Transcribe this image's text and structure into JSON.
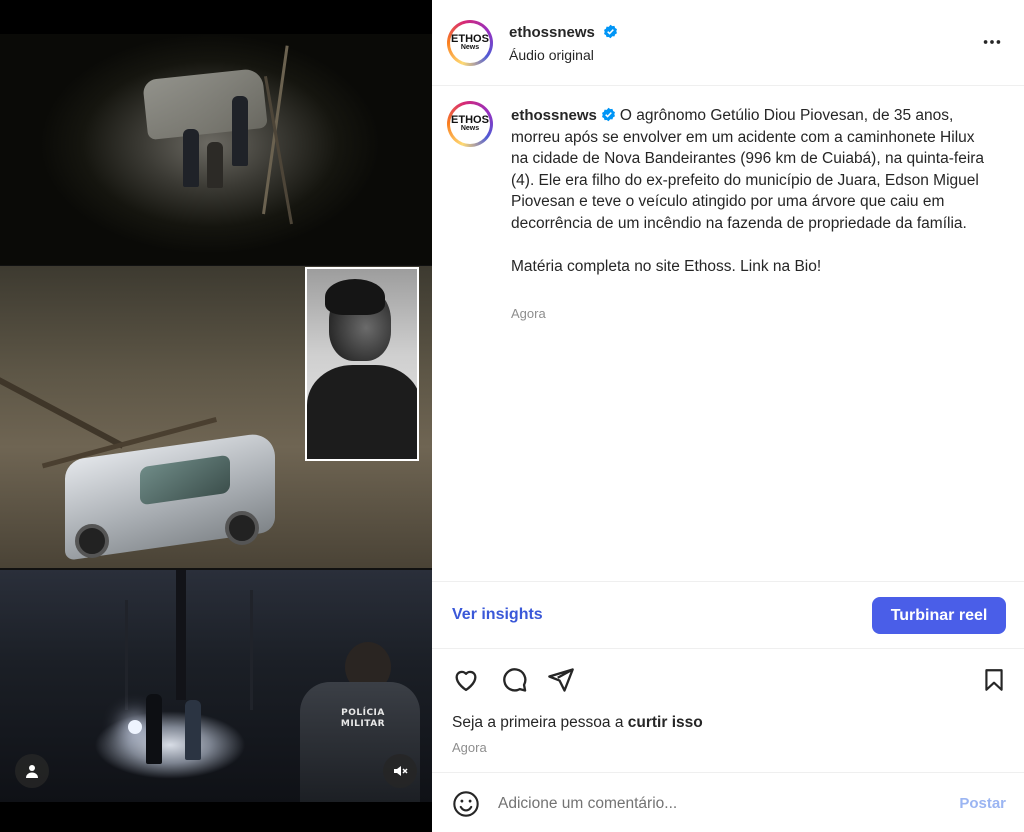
{
  "post": {
    "username": "ethossnews",
    "audio_label": "Áudio original",
    "avatar_logo_main": "ETHOS",
    "avatar_logo_sub": "News",
    "caption_text": "O agrônomo Getúlio Diou Piovesan, de 35 anos, morreu após se envolver em um acidente com a caminhonete Hilux na cidade de Nova Bandeirantes (996 km de Cuiabá), na quinta-feira (4). Ele era filho do ex-prefeito do município de Juara, Edson Miguel Piovesan e teve o veículo atingido por uma árvore que caiu em decorrência de um incêndio na fazenda de propriedade da família.\n\nMatéria completa no site Ethoss. Link na Bio!",
    "caption_time": "Agora"
  },
  "media": {
    "vest_text": "POLÍCIA MILITAR",
    "icons": [
      "user-tag-icon",
      "mute-icon"
    ]
  },
  "insights": {
    "link_label": "Ver insights",
    "boost_label": "Turbinar reel"
  },
  "actions": {
    "icons": [
      "heart-icon",
      "comment-icon",
      "share-icon",
      "bookmark-icon"
    ],
    "likes_prefix": "Seja a primeira pessoa a ",
    "likes_emphasis": "curtir isso",
    "time": "Agora"
  },
  "comment": {
    "placeholder": "Adicione um comentário...",
    "post_label": "Postar"
  },
  "colors": {
    "accent": "#4a5ee8",
    "link": "#3a58d8",
    "verified": "#0095f6",
    "muted": "#8e8e8e",
    "post_disabled": "#9bb5f2"
  }
}
